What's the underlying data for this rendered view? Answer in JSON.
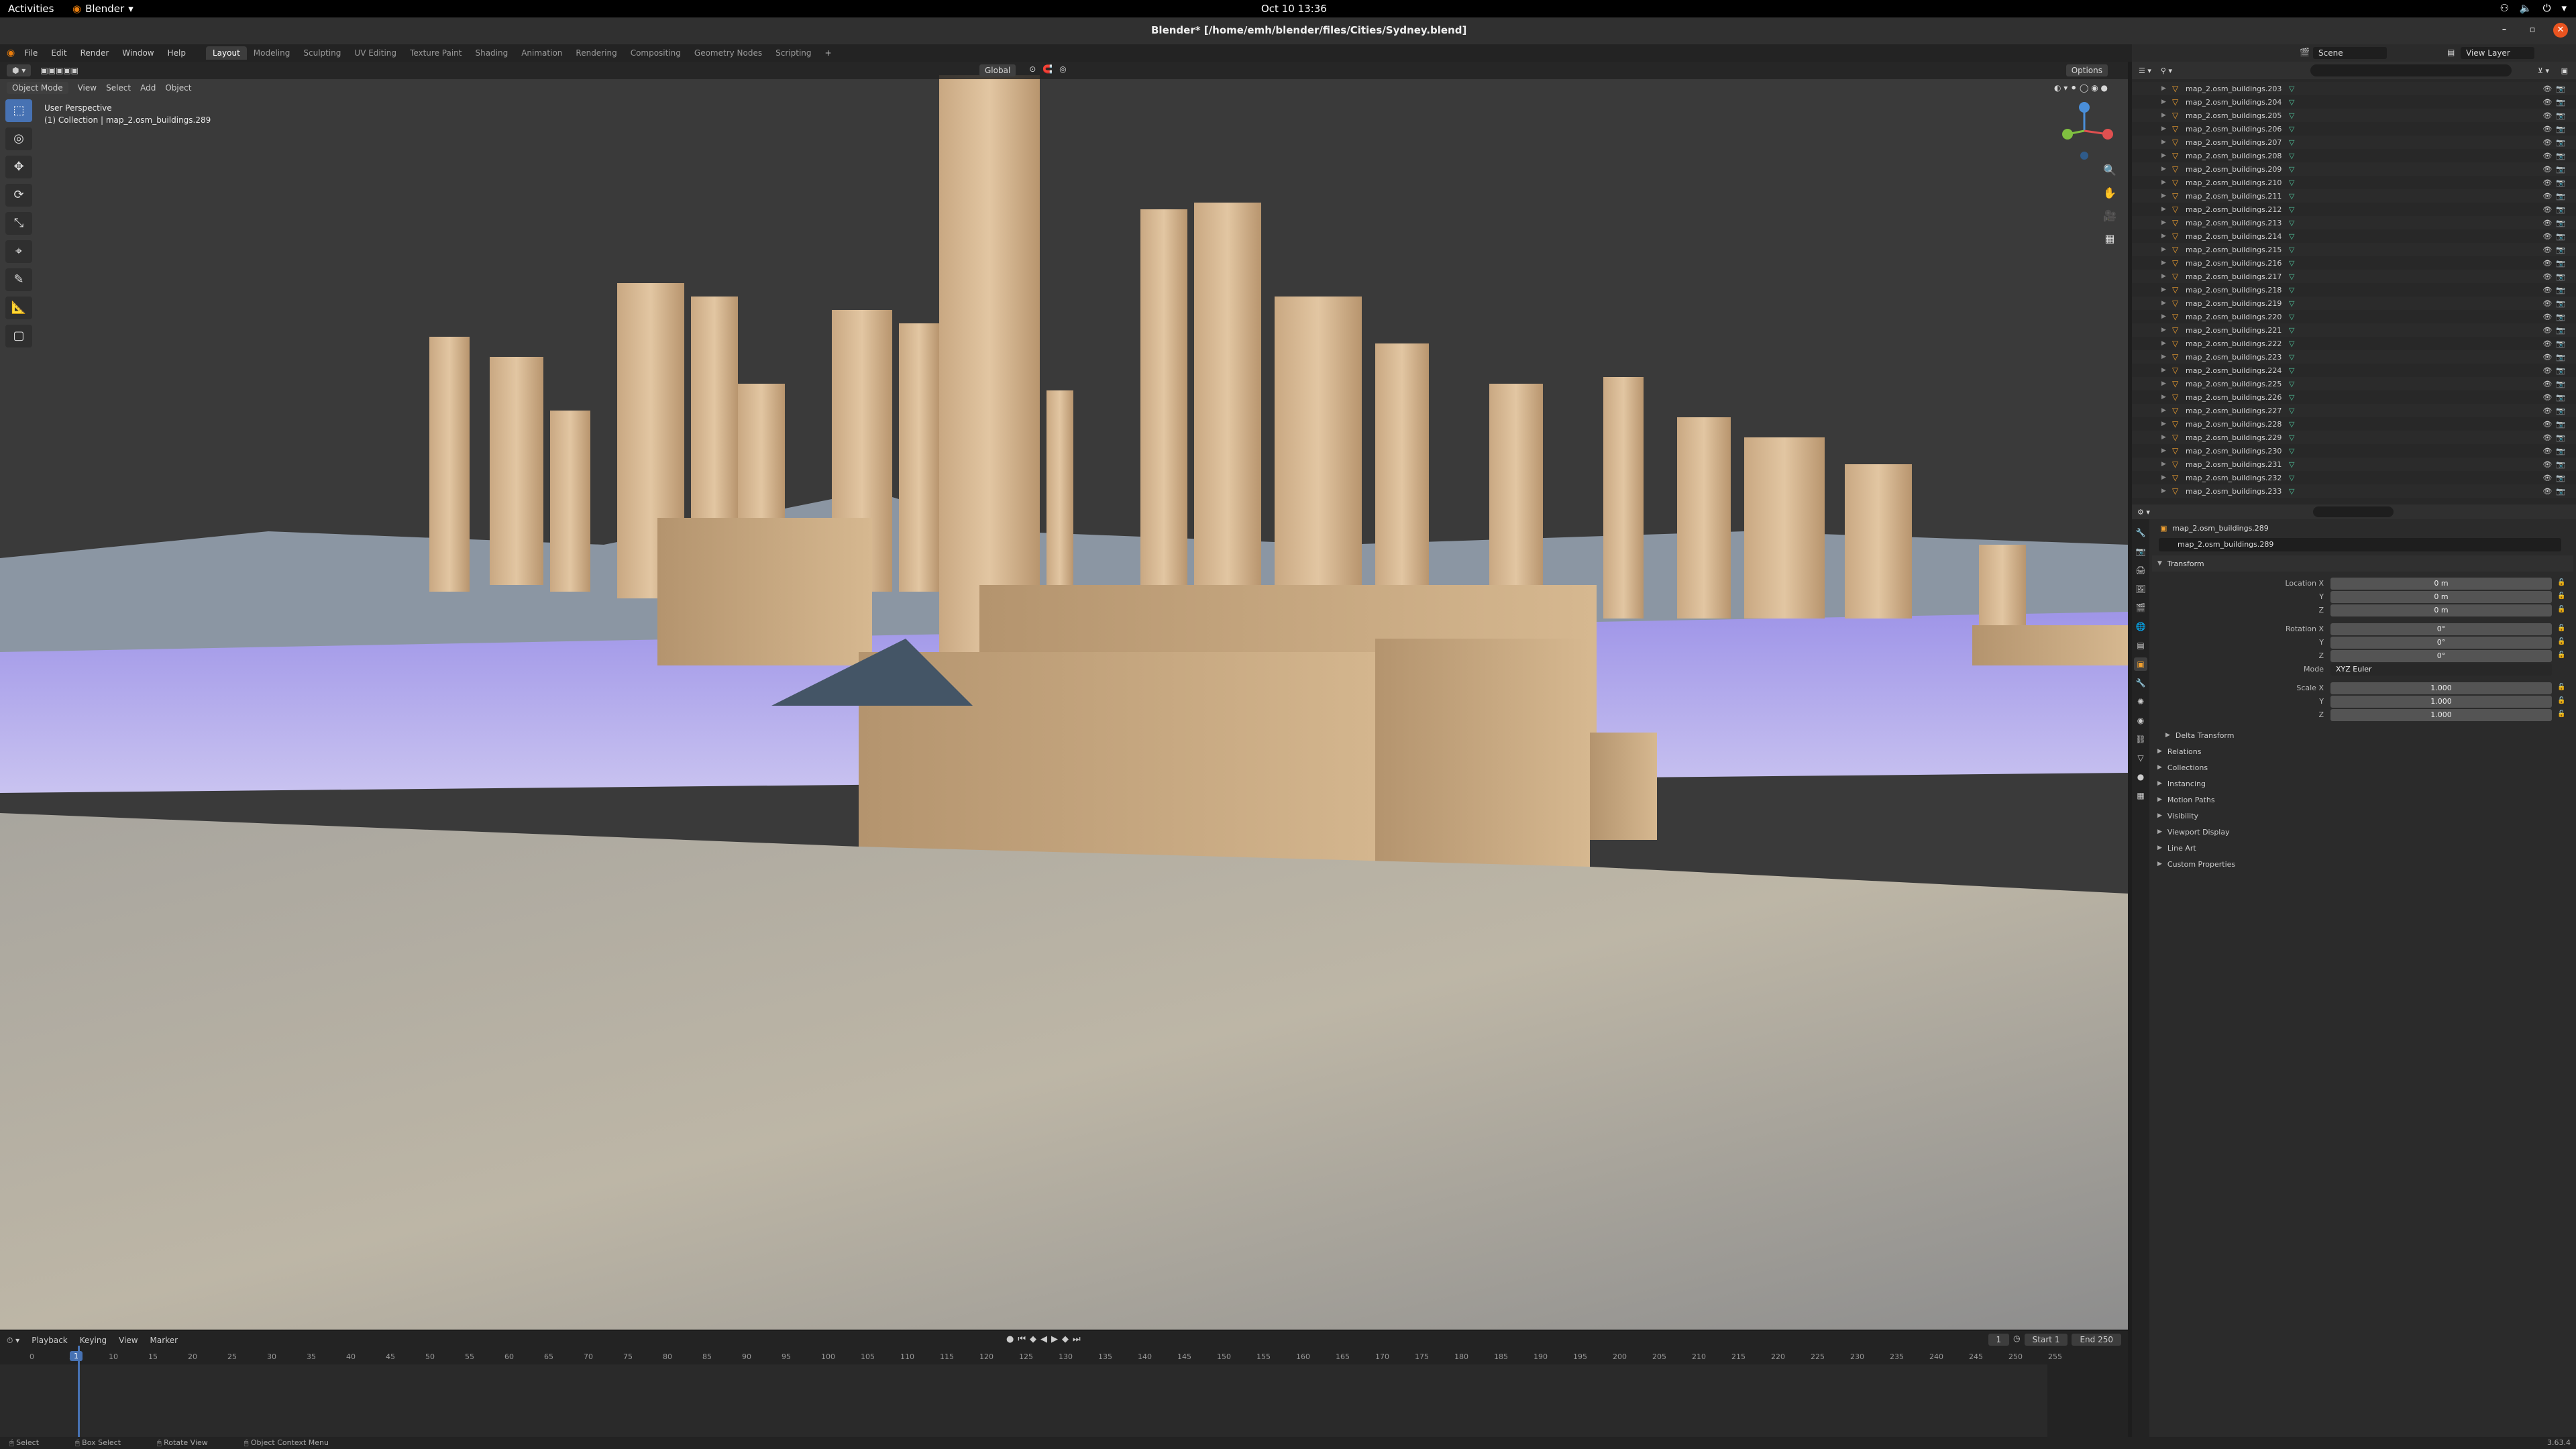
{
  "gnome": {
    "activities": "Activities",
    "app_name": "Blender",
    "clock": "Oct 10  13:36"
  },
  "window": {
    "title": "Blender* [/home/emh/blender/files/Cities/Sydney.blend]"
  },
  "menu": [
    "File",
    "Edit",
    "Render",
    "Window",
    "Help"
  ],
  "workspaces": [
    "Layout",
    "Modeling",
    "Sculpting",
    "UV Editing",
    "Texture Paint",
    "Shading",
    "Animation",
    "Rendering",
    "Compositing",
    "Geometry Nodes",
    "Scripting"
  ],
  "active_workspace": "Layout",
  "viewport": {
    "mode": "Object Mode",
    "menus": [
      "View",
      "Select",
      "Add",
      "Object"
    ],
    "orientation": "Global",
    "options_label": "Options",
    "overlay_line1": "User Perspective",
    "overlay_line2": "(1) Collection | map_2.osm_buildings.289"
  },
  "scene_header": {
    "scene_label": "Scene",
    "view_layer_label": "View Layer"
  },
  "outliner": {
    "items": [
      "map_2.osm_buildings.203",
      "map_2.osm_buildings.204",
      "map_2.osm_buildings.205",
      "map_2.osm_buildings.206",
      "map_2.osm_buildings.207",
      "map_2.osm_buildings.208",
      "map_2.osm_buildings.209",
      "map_2.osm_buildings.210",
      "map_2.osm_buildings.211",
      "map_2.osm_buildings.212",
      "map_2.osm_buildings.213",
      "map_2.osm_buildings.214",
      "map_2.osm_buildings.215",
      "map_2.osm_buildings.216",
      "map_2.osm_buildings.217",
      "map_2.osm_buildings.218",
      "map_2.osm_buildings.219",
      "map_2.osm_buildings.220",
      "map_2.osm_buildings.221",
      "map_2.osm_buildings.222",
      "map_2.osm_buildings.223",
      "map_2.osm_buildings.224",
      "map_2.osm_buildings.225",
      "map_2.osm_buildings.226",
      "map_2.osm_buildings.227",
      "map_2.osm_buildings.228",
      "map_2.osm_buildings.229",
      "map_2.osm_buildings.230",
      "map_2.osm_buildings.231",
      "map_2.osm_buildings.232",
      "map_2.osm_buildings.233"
    ]
  },
  "properties": {
    "object_header": "map_2.osm_buildings.289",
    "object_name": "map_2.osm_buildings.289",
    "transform_label": "Transform",
    "location_label": "Location X",
    "rotation_label": "Rotation X",
    "scale_label": "Scale X",
    "y_label": "Y",
    "z_label": "Z",
    "mode_label": "Mode",
    "location": [
      "0 m",
      "0 m",
      "0 m"
    ],
    "rotation": [
      "0°",
      "0°",
      "0°"
    ],
    "rotation_mode": "XYZ Euler",
    "scale": [
      "1.000",
      "1.000",
      "1.000"
    ],
    "delta_transform": "Delta Transform",
    "sections": [
      "Relations",
      "Collections",
      "Instancing",
      "Motion Paths",
      "Visibility",
      "Viewport Display",
      "Line Art",
      "Custom Properties"
    ]
  },
  "timeline": {
    "menus": [
      "Playback",
      "Keying",
      "View",
      "Marker"
    ],
    "current_frame": "1",
    "start_label": "Start",
    "start": "1",
    "end_label": "End",
    "end": "250",
    "ticks": [
      "0",
      "5",
      "10",
      "15",
      "20",
      "25",
      "30",
      "35",
      "40",
      "45",
      "50",
      "55",
      "60",
      "65",
      "70",
      "75",
      "80",
      "85",
      "90",
      "95",
      "100",
      "105",
      "110",
      "115",
      "120",
      "125",
      "130",
      "135",
      "140",
      "145",
      "150",
      "155",
      "160",
      "165",
      "170",
      "175",
      "180",
      "185",
      "190",
      "195",
      "200",
      "205",
      "210",
      "215",
      "220",
      "225",
      "230",
      "235",
      "240",
      "245",
      "250",
      "255"
    ]
  },
  "statusbar": {
    "select": "Select",
    "box_select": "Box Select",
    "rotate_view": "Rotate View",
    "context_menu": "Object Context Menu",
    "version": "3.63.4"
  },
  "colors": {
    "accent": "#4772b3",
    "object_orange": "#f0a030",
    "mesh_green": "#4fc49b",
    "building": "#d2b48c",
    "water": "#a89cf0"
  }
}
